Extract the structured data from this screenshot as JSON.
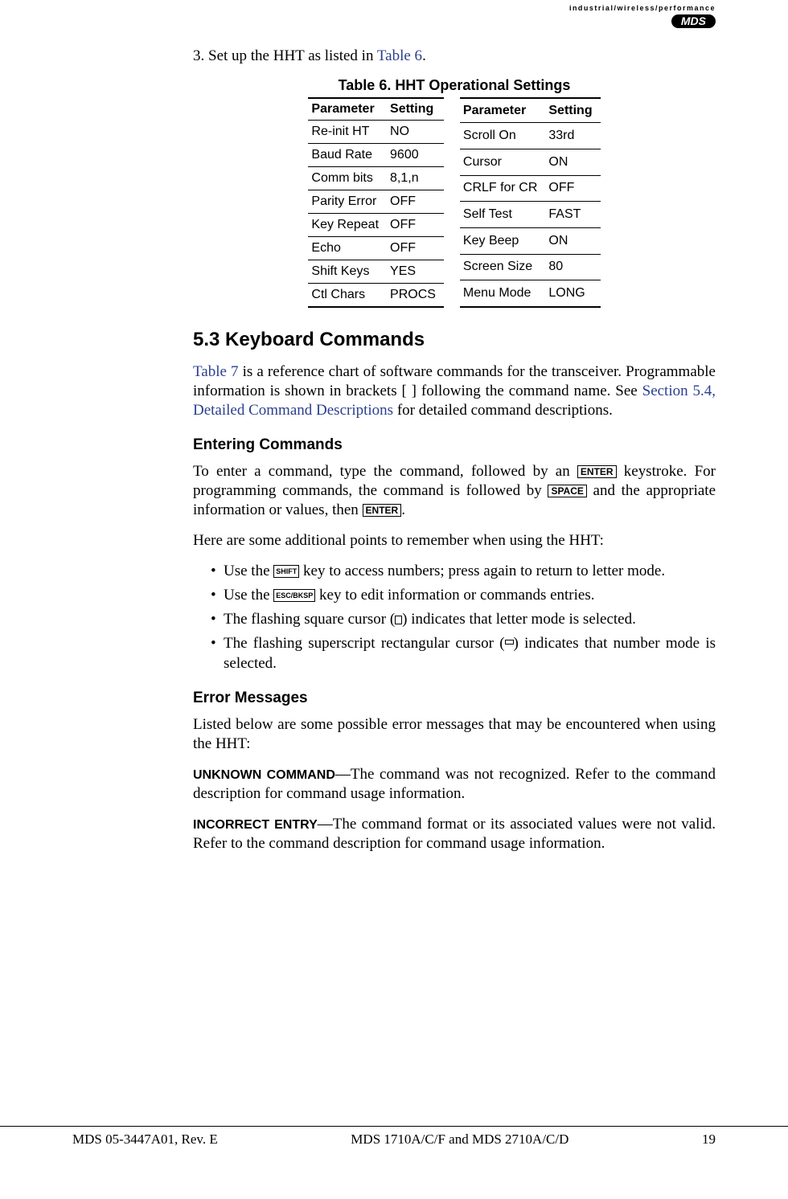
{
  "logo": {
    "tagline": "industrial/wireless/performance",
    "brand": "MDS"
  },
  "step3": {
    "prefix": "3.  Set up the HHT as listed in ",
    "link": "Table 6",
    "suffix": "."
  },
  "table6": {
    "caption": "Table 6. HHT Operational Settings",
    "head_param": "Parameter",
    "head_set": "Setting",
    "left": [
      {
        "p": "Re-init HT",
        "s": "NO"
      },
      {
        "p": "Baud Rate",
        "s": "9600"
      },
      {
        "p": "Comm bits",
        "s": "8,1,n"
      },
      {
        "p": "Parity Error",
        "s": "OFF"
      },
      {
        "p": "Key Repeat",
        "s": "OFF"
      },
      {
        "p": "Echo",
        "s": "OFF"
      },
      {
        "p": "Shift Keys",
        "s": "YES"
      },
      {
        "p": "Ctl Chars",
        "s": "PROCS"
      }
    ],
    "right": [
      {
        "p": "Scroll On",
        "s": "33rd"
      },
      {
        "p": "Cursor",
        "s": "ON"
      },
      {
        "p": "CRLF for CR",
        "s": "OFF"
      },
      {
        "p": "Self Test",
        "s": "FAST"
      },
      {
        "p": "Key Beep",
        "s": "ON"
      },
      {
        "p": "Screen Size",
        "s": "80"
      },
      {
        "p": "Menu Mode",
        "s": "LONG"
      }
    ]
  },
  "sec53": {
    "title": "5.3   Keyboard Commands",
    "p1_a": "Table 7",
    "p1_b": " is a reference chart of software commands for the transceiver. Programmable information is shown in brackets [ ] following the command name. See ",
    "p1_c": "Section 5.4, Detailed Command Descriptions",
    "p1_d": " for detailed command descriptions."
  },
  "entering": {
    "title": "Entering Commands",
    "p1_a": "To enter a command, type the command, followed by an ",
    "key_enter": "ENTER",
    "p1_b": " keystroke. For programming commands, the command is followed by ",
    "key_space": "SPACE",
    "p1_c": " and the appropriate information or values, then ",
    "p1_d": ".",
    "p2": "Here are some additional points to remember when using the HHT:",
    "b1_a": "Use the ",
    "key_shift": "SHIFT",
    "b1_b": " key to access numbers; press again to return to letter mode.",
    "b2_a": "Use the ",
    "key_esc": "ESC/BKSP",
    "b2_b": " key to edit information or commands entries.",
    "b3_a": "The flashing square cursor (",
    "b3_b": ") indicates that letter mode is selected.",
    "b4_a": "The flashing superscript rectangular cursor (",
    "b4_b": ") indicates that number mode is selected."
  },
  "errors": {
    "title": "Error Messages",
    "intro": "Listed below are some possible error messages that may be encountered when using the HHT:",
    "e1_label": "UNKNOWN COMMAND",
    "e1_text": "—The command was not recognized. Refer to the command description for command usage information.",
    "e2_label": "INCORRECT ENTRY",
    "e2_text": "—The command format or its associated values were not valid. Refer to the command description for command usage information."
  },
  "footer": {
    "left": "MDS 05-3447A01, Rev. E",
    "center": "MDS 1710A/C/F and MDS 2710A/C/D",
    "right": "19"
  }
}
